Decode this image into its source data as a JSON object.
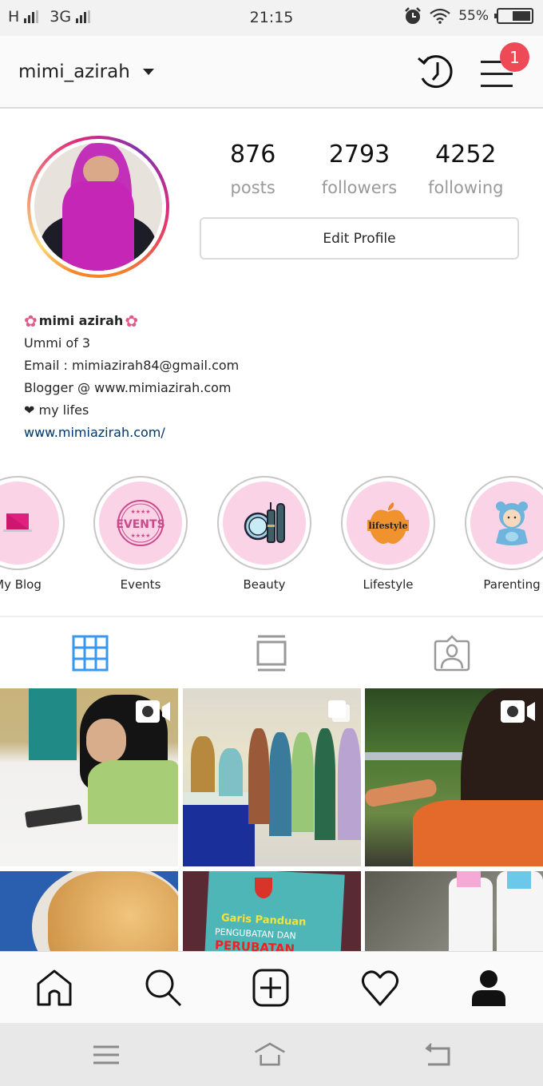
{
  "status_bar": {
    "network_1": "H",
    "network_2": "3G",
    "time": "21:15",
    "battery": "55%",
    "icons": [
      "signal-icon",
      "alarm-icon",
      "wifi-icon",
      "battery-icon"
    ]
  },
  "header": {
    "username": "mimi_azirah",
    "notification_count": "1",
    "icons": [
      "chevron-down-icon",
      "history-icon",
      "menu-icon"
    ]
  },
  "profile": {
    "stats": [
      {
        "value": "876",
        "label": "posts"
      },
      {
        "value": "2793",
        "label": "followers"
      },
      {
        "value": "4252",
        "label": "following"
      }
    ],
    "edit_profile_label": "Edit Profile",
    "bio": {
      "flower": "✿",
      "name": "mimi azirah",
      "lines": [
        "Ummi of 3",
        "Email : mimiazirah84@gmail.com",
        "Blogger @ www.mimiazirah.com"
      ],
      "heart": "❤",
      "heart_line": "my lifes",
      "link": "www.mimiazirah.com/"
    }
  },
  "highlights": [
    {
      "label": "My Blog",
      "icon": "laptop-icon"
    },
    {
      "label": "Events",
      "icon": "events-stamp-icon",
      "stamp_text": "EVENTS"
    },
    {
      "label": "Beauty",
      "icon": "makeup-icon"
    },
    {
      "label": "Lifestyle",
      "icon": "apple-icon",
      "apple_text": "lifestyle"
    },
    {
      "label": "Parenting",
      "icon": "baby-icon"
    }
  ],
  "tabs": [
    {
      "name": "grid",
      "icon": "grid-icon",
      "active": true
    },
    {
      "name": "feed",
      "icon": "feed-icon",
      "active": false
    },
    {
      "name": "tagged",
      "icon": "tagged-icon",
      "active": false
    }
  ],
  "posts": [
    {
      "type": "video",
      "description": "woman in hijab at table with phone"
    },
    {
      "type": "multiple",
      "description": "group photo at event"
    },
    {
      "type": "video",
      "description": "child reaching toward greenery"
    },
    {
      "type": "photo",
      "description": "bread bun"
    },
    {
      "type": "photo",
      "description": "book cover",
      "text_1": "Garis Panduan",
      "text_2": "PENGUBATAN DAN",
      "text_3": "PERUBATAN"
    },
    {
      "type": "photo",
      "description": "two lotion bottles"
    }
  ],
  "bottom_nav": [
    {
      "name": "home",
      "icon": "home-icon"
    },
    {
      "name": "search",
      "icon": "search-icon"
    },
    {
      "name": "new-post",
      "icon": "add-post-icon"
    },
    {
      "name": "activity",
      "icon": "heart-icon"
    },
    {
      "name": "profile",
      "icon": "profile-icon",
      "active": true
    }
  ],
  "system_nav": [
    "recent-apps-icon",
    "home-icon",
    "back-icon"
  ],
  "colors": {
    "accent": "#3897f0",
    "badge": "#ed4956",
    "highlight_bg": "#fbd3e6",
    "link": "#003569"
  }
}
